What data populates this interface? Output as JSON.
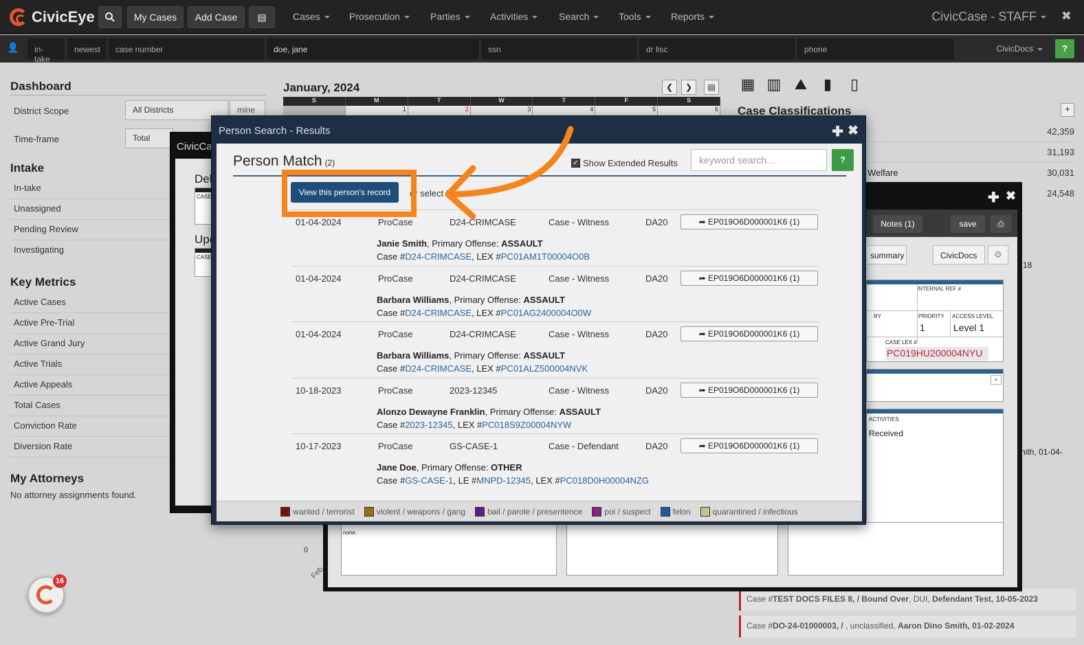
{
  "app": {
    "name": "CivicEye",
    "title": "CivicCase - STAFF"
  },
  "toolbar": {
    "my_cases": "My Cases",
    "add_case": "Add Case"
  },
  "nav": [
    "Cases",
    "Prosecution",
    "Parties",
    "Activities",
    "Search",
    "Tools",
    "Reports"
  ],
  "searchbar": {
    "intake": "in-take",
    "newest": "newest",
    "case_number": "case number",
    "name": "doe, jane",
    "ssn": "ssn",
    "dl": "dr lisc",
    "phone": "phone",
    "civicdocs": "CivicDocs",
    "help": "?"
  },
  "sidebar": {
    "dashboard": "Dashboard",
    "district_scope_label": "District Scope",
    "district_scope_value": "All Districts",
    "mine": "mine",
    "timeframe_label": "Time-frame",
    "timeframe_value": "Total",
    "intake_head": "Intake",
    "intake_items": [
      "In-take",
      "Unassigned",
      "Pending Review",
      "Investigating"
    ],
    "metrics_head": "Key Metrics",
    "metrics_items": [
      "Active Cases",
      "Active Pre-Trial",
      "Active Grand Jury",
      "Active Trials",
      "Active Appeals",
      "Total Cases",
      "Conviction Rate",
      "Diversion Rate"
    ],
    "attorneys_head": "My Attorneys",
    "attorneys_text": "No attorney assignments found."
  },
  "calendar": {
    "title": "January, 2024",
    "days": [
      "S",
      "M",
      "T",
      "W",
      "T",
      "F",
      "S"
    ],
    "dates": [
      "",
      "1",
      "2",
      "3",
      "4",
      "5",
      "6"
    ]
  },
  "classifications": {
    "title": "Case Classifications",
    "rows": [
      {
        "label": "",
        "value": "42,359"
      },
      {
        "label": "",
        "value": "31,193"
      },
      {
        "label": "Welfare",
        "value": "30,031"
      },
      {
        "label": "",
        "value": "24,548"
      }
    ]
  },
  "bg_modal1": {
    "title": "CivicCa",
    "del": "Del",
    "case": "CASE",
    "upc": "Upc",
    "case2": "CASE"
  },
  "bg_modal2": {
    "notes": "Notes (1)",
    "save": "save",
    "summary": "summary",
    "civicdocs": "CivicDocs",
    "internal_ref": "INTERNAL REF #",
    "priority_label": "PRIORITY",
    "priority": "1",
    "access_label": "ACCESS LEVEL",
    "access": "Level 1",
    "ry": "RY",
    "case_lex_label": "CASE LEX #",
    "case_lex": "PC019HU200004NYU",
    "activities": "ACTIVITIES",
    "received": "Received",
    "none": "none.",
    "zero": "0",
    "feb": "Feb",
    "eighteen": "18",
    "smith": "hith, 01-04-"
  },
  "modal": {
    "title": "Person Search - Results",
    "plus": "✚",
    "close": "✖",
    "heading": "Person Match",
    "count": "(2)",
    "extended": "Show Extended Results",
    "keyword_placeholder": "keyword search...",
    "go": "?",
    "view_btn": "View this person's record",
    "or_select": "or select I",
    "rows": [
      {
        "date": "01-04-2024",
        "src": "ProCase",
        "case": "D24-CRIMCASE",
        "role": "Case - Witness",
        "dept": "DA20",
        "ep": "EP019O6D000001K6 (1)",
        "name": "Janie Smith",
        "offense_label": ", Primary Offense: ",
        "offense": "ASSAULT",
        "case_prefix": "Case #",
        "case_link": "D24-CRIMCASE",
        "lex_prefix": ", LEX #",
        "lex": "PC01AM1T00004O0B",
        "le": ""
      },
      {
        "date": "01-04-2024",
        "src": "ProCase",
        "case": "D24-CRIMCASE",
        "role": "Case - Witness",
        "dept": "DA20",
        "ep": "EP019O6D000001K6 (1)",
        "name": "Barbara Williams",
        "offense_label": ", Primary Offense: ",
        "offense": "ASSAULT",
        "case_prefix": "Case #",
        "case_link": "D24-CRIMCASE",
        "lex_prefix": ", LEX #",
        "lex": "PC01AG2400004O0W",
        "le": ""
      },
      {
        "date": "01-04-2024",
        "src": "ProCase",
        "case": "D24-CRIMCASE",
        "role": "Case - Witness",
        "dept": "DA20",
        "ep": "EP019O6D000001K6 (1)",
        "name": "Barbara Williams",
        "offense_label": ", Primary Offense: ",
        "offense": "ASSAULT",
        "case_prefix": "Case #",
        "case_link": "D24-CRIMCASE",
        "lex_prefix": ", LEX #",
        "lex": "PC01ALZ500004NVK",
        "le": ""
      },
      {
        "date": "10-18-2023",
        "src": "ProCase",
        "case": "2023-12345",
        "role": "Case - Witness",
        "dept": "DA20",
        "ep": "EP019O6D000001K6 (1)",
        "name": "Alonzo Dewayne Franklin",
        "offense_label": ", Primary Offense: ",
        "offense": "ASSAULT",
        "case_prefix": "Case #",
        "case_link": "2023-12345",
        "lex_prefix": ", LEX #",
        "lex": "PC018S9Z00004NYW",
        "le": ""
      },
      {
        "date": "10-17-2023",
        "src": "ProCase",
        "case": "GS-CASE-1",
        "role": "Case - Defendant",
        "dept": "DA20",
        "ep": "EP019O6D000001K6 (1)",
        "name": "Jane Doe",
        "offense_label": ", Primary Offense: ",
        "offense": "OTHER",
        "case_prefix": "Case #",
        "case_link": "GS-CASE-1",
        "lex_prefix": ", LEX #",
        "lex": "PC018D0H00004NZG",
        "le_prefix": ", LE #",
        "le": "MNPD-12345"
      }
    ],
    "legend": [
      {
        "label": "wanted / terrorist",
        "color": "#7a0f0f"
      },
      {
        "label": "violent / weapons / gang",
        "color": "#9a6b1e"
      },
      {
        "label": "bail / parole / presentence",
        "color": "#5a1e8a"
      },
      {
        "label": "poi / suspect",
        "color": "#8a1e8a"
      },
      {
        "label": "felon",
        "color": "#1e5aa8"
      },
      {
        "label": "quarantined / infectious",
        "color": "#c9c08a"
      }
    ]
  },
  "bottom_cases": [
    {
      "prefix": "Case #",
      "id": "TEST DOCS FILES 8, / Bound Over",
      "mid": ", DUI, ",
      "party": "Defendant Test, 10-05-2023"
    },
    {
      "prefix": "Case #",
      "id": "DO-24-01000003, /",
      "mid": " , unclassified, ",
      "party": "Aaron Dino Smith, 01-02-2024"
    }
  ],
  "notifications": {
    "count": "16"
  },
  "colors": {
    "accent": "#f5841f",
    "brand": "#e0582f",
    "primary": "#1f4d7a",
    "link": "#2a64a4"
  }
}
